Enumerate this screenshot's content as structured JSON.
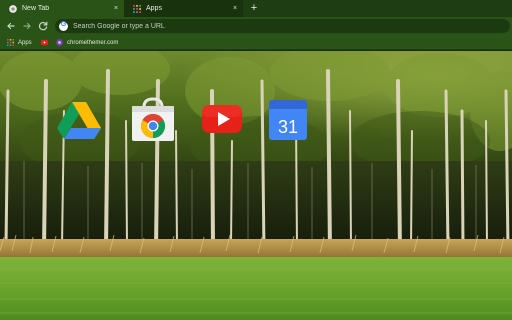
{
  "tabs": [
    {
      "title": "New Tab",
      "close": "×"
    },
    {
      "title": "Apps",
      "close": "×"
    }
  ],
  "new_tab_label": "+",
  "omnibox": {
    "placeholder": "Search Google or type a URL",
    "value": ""
  },
  "bookmarks": [
    {
      "label": "Apps",
      "icon": "apps-grid-icon"
    },
    {
      "label": "",
      "icon": "youtube-icon"
    },
    {
      "label": "chromethemer.com",
      "icon": "chromethemer-icon"
    }
  ],
  "apps": [
    {
      "name": "Google Drive",
      "icon": "google-drive-icon"
    },
    {
      "name": "Chrome Web Store",
      "icon": "chrome-web-store-icon"
    },
    {
      "name": "YouTube",
      "icon": "youtube-icon"
    },
    {
      "name": "Google Calendar",
      "icon": "google-calendar-icon",
      "day": "31"
    }
  ],
  "theme_colors": {
    "frame": "#1e3d12",
    "toolbar": "#2a5318",
    "accent": "#4b8a2a"
  }
}
